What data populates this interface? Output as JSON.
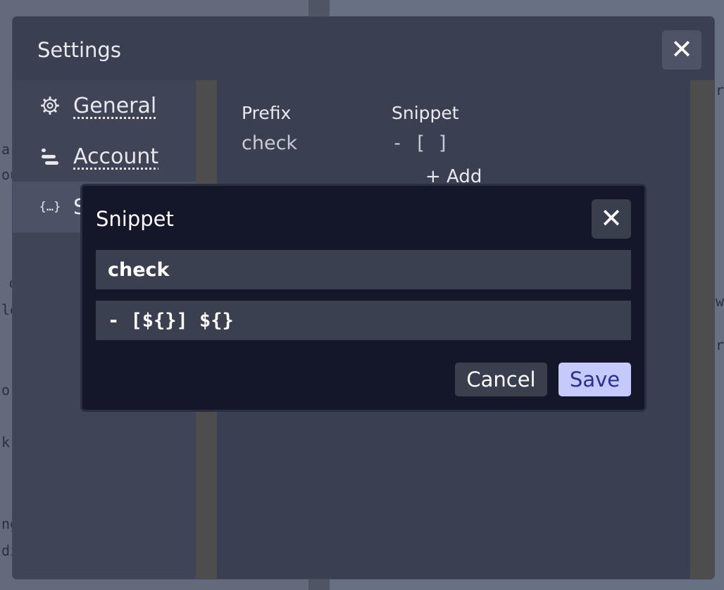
{
  "settings": {
    "title": "Settings",
    "close_icon": "close-icon",
    "sidebar": {
      "items": [
        {
          "label": "General",
          "icon": "gear-icon",
          "active": false
        },
        {
          "label": "Account",
          "icon": "account-icon",
          "active": false
        },
        {
          "label": "S",
          "icon": "braces-icon",
          "active": true
        }
      ]
    },
    "table": {
      "headers": [
        "Prefix",
        "Snippet"
      ],
      "rows": [
        {
          "prefix": "check",
          "snippet": "- [ ]"
        }
      ],
      "add_label": "+ Add"
    }
  },
  "dialog": {
    "title": "Snippet",
    "prefix_value": "check",
    "body_value": "- [${}] ${}",
    "cancel_label": "Cancel",
    "save_label": "Save"
  },
  "background": {
    "fragments": [
      "a",
      "ou",
      "c",
      "lo",
      "o:",
      "k",
      "ng",
      "di",
      "r",
      "w",
      "r"
    ]
  },
  "colors": {
    "panel": "#3a3f52",
    "dialog": "#131729",
    "save_bg": "#c5c9fb",
    "save_text": "#2c2f8e"
  }
}
